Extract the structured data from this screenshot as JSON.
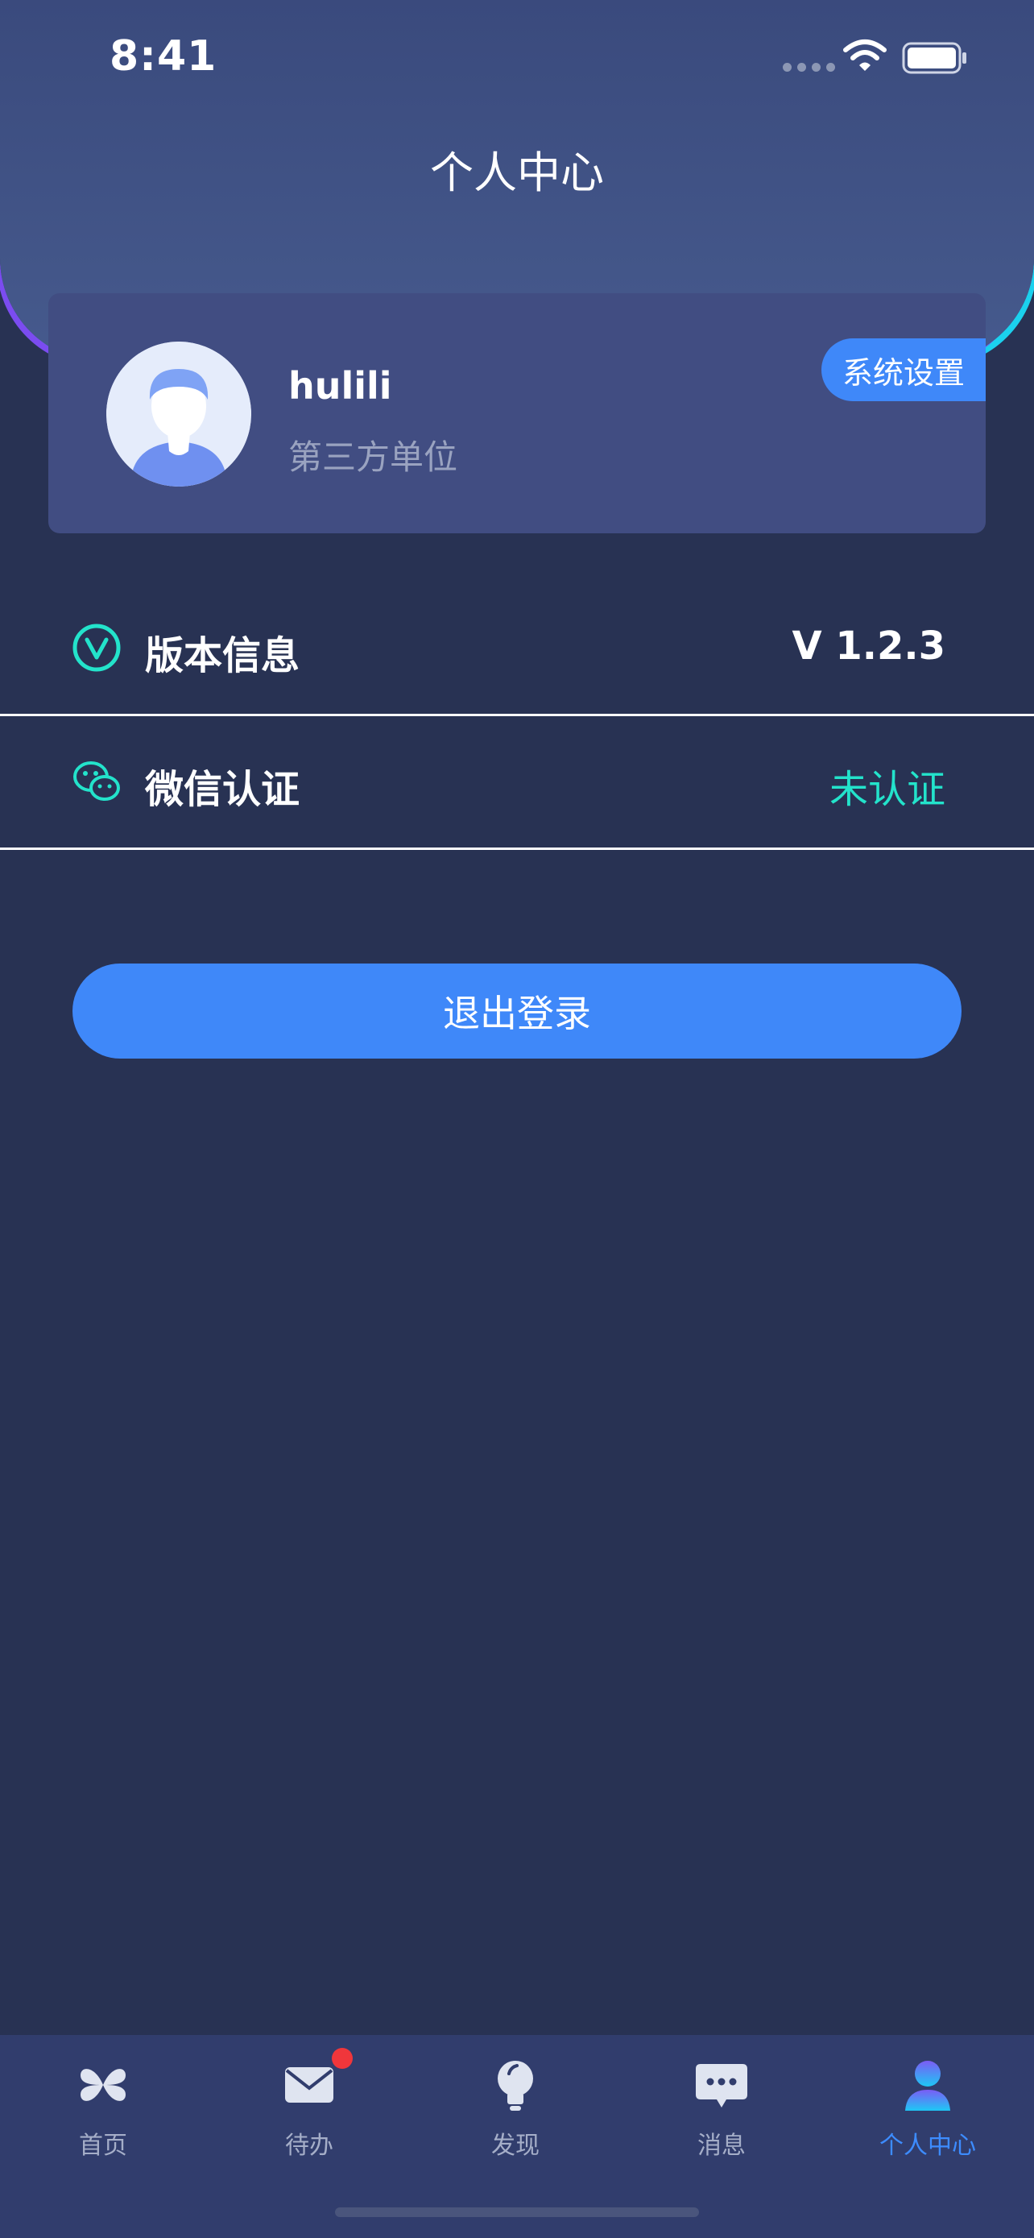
{
  "status_bar": {
    "time": "8:41"
  },
  "header": {
    "title": "个人中心"
  },
  "profile": {
    "username": "hulili",
    "organization": "第三方单位",
    "settings_label": "系统设置"
  },
  "rows": {
    "version": {
      "label": "版本信息",
      "value": "V 1.2.3",
      "icon": "version-check-icon"
    },
    "wechat": {
      "label": "微信认证",
      "value": "未认证",
      "icon": "wechat-icon"
    }
  },
  "logout_label": "退出登录",
  "tabbar": {
    "tabs": [
      {
        "label": "首页",
        "icon": "grid-icon"
      },
      {
        "label": "待办",
        "icon": "mail-icon",
        "badge": true
      },
      {
        "label": "发现",
        "icon": "bulb-icon"
      },
      {
        "label": "消息",
        "icon": "chat-icon"
      },
      {
        "label": "个人中心",
        "icon": "person-icon",
        "active": true
      }
    ]
  },
  "colors": {
    "background": "#283253",
    "accent_blue": "#3f88f9",
    "accent_teal": "#23e3cb",
    "badge_red": "#f0363b"
  }
}
